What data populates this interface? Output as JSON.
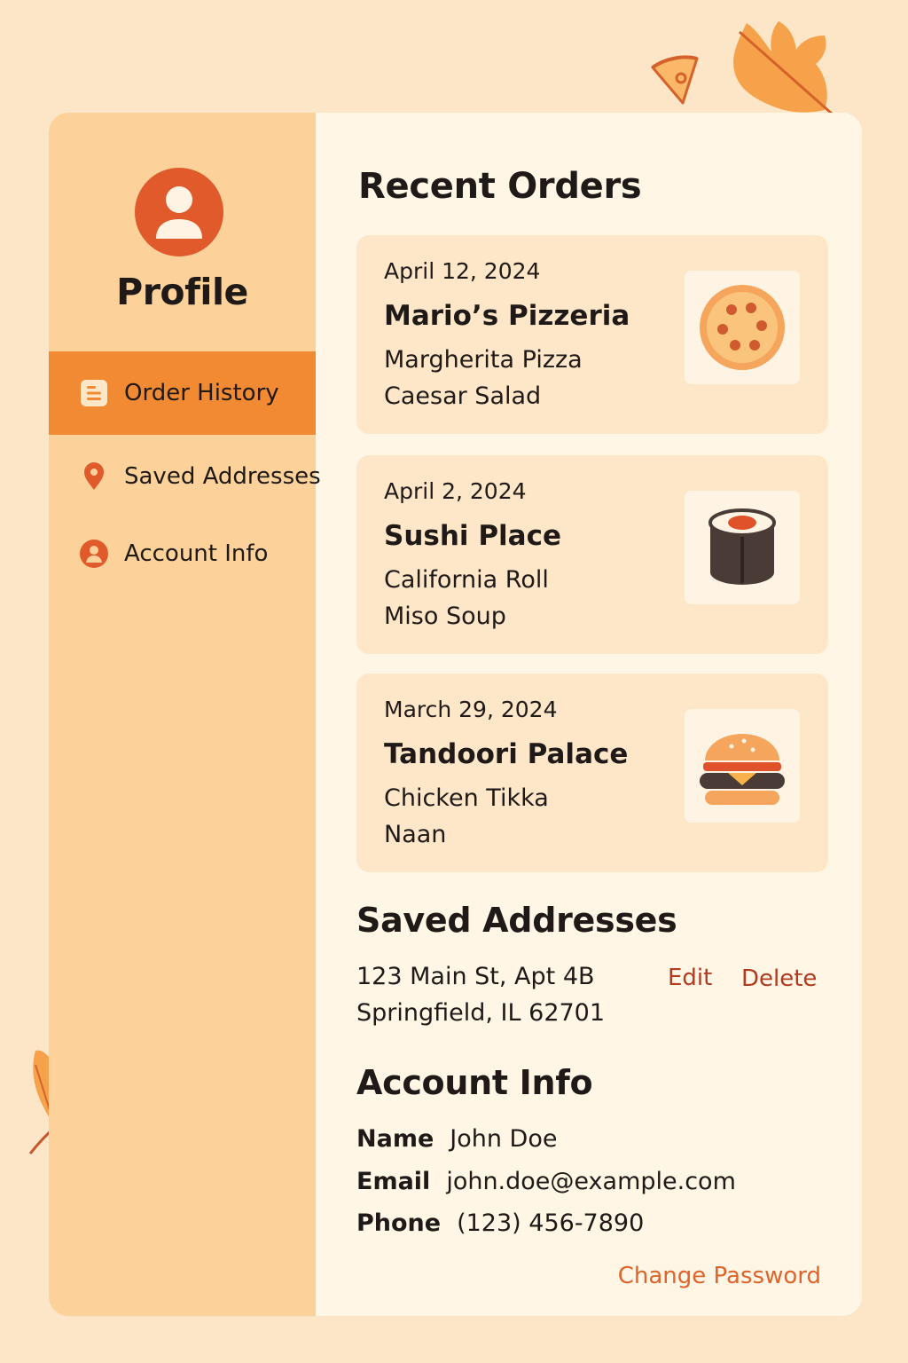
{
  "sidebar": {
    "title": "Profile",
    "items": [
      {
        "label": "Order History",
        "icon": "list-icon",
        "active": true
      },
      {
        "label": "Saved Addresses",
        "icon": "map-pin-icon",
        "active": false
      },
      {
        "label": "Account Info",
        "icon": "user-circle-icon",
        "active": false
      }
    ]
  },
  "recent_orders": {
    "heading": "Recent Orders",
    "orders": [
      {
        "date": "April 12, 2024",
        "restaurant": "Mario’s Pizzeria",
        "items": [
          "Margherita Pizza",
          "Caesar Salad"
        ],
        "icon": "pizza-icon"
      },
      {
        "date": "April 2, 2024",
        "restaurant": "Sushi Place",
        "items": [
          "California Roll",
          "Miso Soup"
        ],
        "icon": "sushi-icon"
      },
      {
        "date": "March 29, 2024",
        "restaurant": "Tandoori Palace",
        "items": [
          "Chicken Tikka",
          "Naan"
        ],
        "icon": "burger-icon"
      }
    ]
  },
  "saved_addresses": {
    "heading": "Saved Addresses",
    "address_line1": "123 Main St, Apt 4B",
    "address_line2": "Springfield, IL 62701",
    "edit_label": "Edit",
    "delete_label": "Delete"
  },
  "account_info": {
    "heading": "Account Info",
    "name_label": "Name",
    "name_value": "John Doe",
    "email_label": "Email",
    "email_value": "john.doe@example.com",
    "phone_label": "Phone",
    "phone_value": "(123) 456-7890",
    "change_password_label": "Change Password"
  },
  "colors": {
    "page_bg": "#fde6c8",
    "sidebar_bg": "#fdd19a",
    "active_item_bg": "#f28a34",
    "content_bg": "#fff6e6",
    "card_bg": "#fde7c8",
    "accent_orange": "#e0642a",
    "link_red": "#b23a1f"
  }
}
